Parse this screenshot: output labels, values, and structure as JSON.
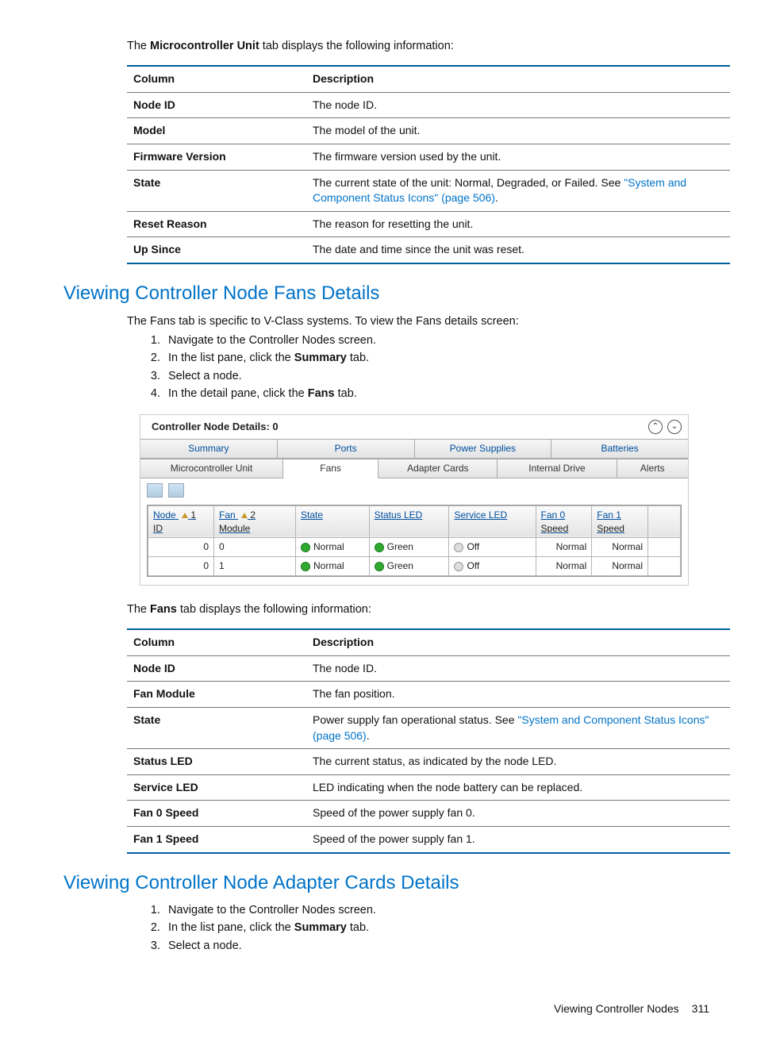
{
  "intro1_pre": "The ",
  "intro1_bold": "Microcontroller Unit",
  "intro1_post": " tab displays the following information:",
  "table1_head": {
    "c1": "Column",
    "c2": "Description"
  },
  "table1": {
    "r0": {
      "c1": "Node ID",
      "c2": "The node ID."
    },
    "r1": {
      "c1": "Model",
      "c2": "The model of the unit."
    },
    "r2": {
      "c1": "Firmware Version",
      "c2": "The firmware version used by the unit."
    },
    "r3": {
      "c1": "State",
      "c2a": "The current state of the unit: Normal, Degraded, or Failed. See ",
      "c2link": "\"System and Component Status Icons\" (page 506)",
      "c2b": "."
    },
    "r4": {
      "c1": "Reset Reason",
      "c2": "The reason for resetting the unit."
    },
    "r5": {
      "c1": "Up Since",
      "c2": "The date and time since the unit was reset."
    }
  },
  "h2a": "Viewing Controller Node Fans Details",
  "fans_intro": "The Fans tab is specific to V-Class systems. To view the Fans details screen:",
  "stepsA": {
    "s1": "Navigate to the Controller Nodes screen.",
    "s2_a": "In the list pane, click the ",
    "s2_b": "Summary",
    "s2_c": " tab.",
    "s3": "Select a node.",
    "s4_a": "In the detail pane, click the ",
    "s4_b": "Fans",
    "s4_c": " tab."
  },
  "fig": {
    "title": "Controller Node Details: 0",
    "tabs_top": {
      "t0": "Summary",
      "t1": "Ports",
      "t2": "Power Supplies",
      "t3": "Batteries"
    },
    "tabs_bot": {
      "t0": "Microcontroller Unit",
      "t1": "Fans",
      "t2": "Adapter Cards",
      "t3": "Internal Drive",
      "t4": "Alerts"
    },
    "cols": {
      "c0a": "Node",
      "c0b": "ID",
      "c0s": "1",
      "c1a": "Fan",
      "c1b": "Module",
      "c1s": "2",
      "c2": "State",
      "c3": "Status LED",
      "c4": "Service LED",
      "c5a": "Fan 0",
      "c5b": "Speed",
      "c6a": "Fan 1",
      "c6b": "Speed"
    },
    "rows": {
      "r0": {
        "node": "0",
        "fan": "0",
        "state": "Normal",
        "status": "Green",
        "service": "Off",
        "s0": "Normal",
        "s1": "Normal"
      },
      "r1": {
        "node": "0",
        "fan": "1",
        "state": "Normal",
        "status": "Green",
        "service": "Off",
        "s0": "Normal",
        "s1": "Normal"
      }
    }
  },
  "intro2_pre": "The ",
  "intro2_bold": "Fans",
  "intro2_post": " tab displays the following information:",
  "table2_head": {
    "c1": "Column",
    "c2": "Description"
  },
  "table2": {
    "r0": {
      "c1": "Node ID",
      "c2": "The node ID."
    },
    "r1": {
      "c1": "Fan Module",
      "c2": "The fan position."
    },
    "r2": {
      "c1": "State",
      "c2a": "Power supply fan operational status. See ",
      "c2link": "\"System and Component Status Icons\" (page 506)",
      "c2b": "."
    },
    "r3": {
      "c1": "Status LED",
      "c2": "The current status, as indicated by the node LED."
    },
    "r4": {
      "c1": "Service LED",
      "c2": "LED indicating when the node battery can be replaced."
    },
    "r5": {
      "c1": "Fan 0 Speed",
      "c2": "Speed of the power supply fan 0."
    },
    "r6": {
      "c1": "Fan 1 Speed",
      "c2": "Speed of the power supply fan 1."
    }
  },
  "h2b": "Viewing Controller Node Adapter Cards Details",
  "stepsB": {
    "s1": "Navigate to the Controller Nodes screen.",
    "s2_a": "In the list pane, click the ",
    "s2_b": "Summary",
    "s2_c": " tab.",
    "s3": "Select a node."
  },
  "footer": {
    "label": "Viewing Controller Nodes",
    "page": "311"
  }
}
